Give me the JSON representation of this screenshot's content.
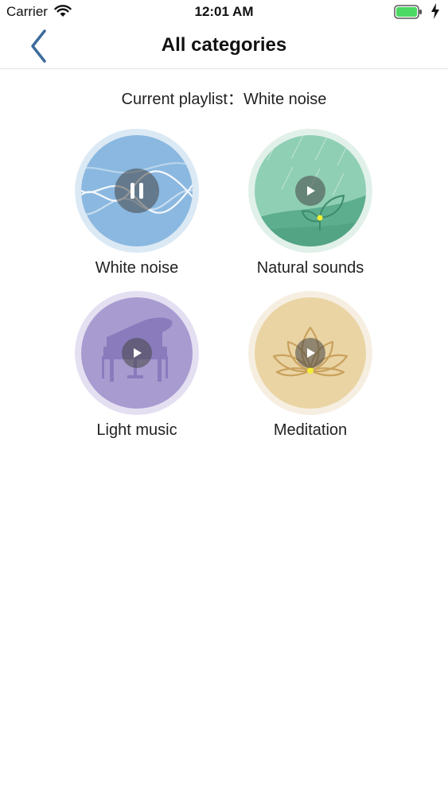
{
  "status": {
    "carrier": "Carrier",
    "time": "12:01 AM"
  },
  "nav": {
    "title": "All categories"
  },
  "current": {
    "label": "Current playlist：",
    "value": "White noise"
  },
  "categories": [
    {
      "label": "White noise",
      "state": "playing"
    },
    {
      "label": "Natural sounds",
      "state": "paused"
    },
    {
      "label": "Light music",
      "state": "paused"
    },
    {
      "label": "Meditation",
      "state": "paused"
    }
  ],
  "icons": [
    "wifi-icon",
    "battery-icon",
    "charging-icon",
    "back-chevron-icon",
    "pause-icon",
    "play-icon"
  ],
  "colors": {
    "white_noise": "#8ab8e0",
    "natural_sounds": "#8fcfb4",
    "light_music": "#a89bd0",
    "meditation": "#ead4a4",
    "accent_blue": "#3d6b9c",
    "battery_green": "#4cd964"
  }
}
